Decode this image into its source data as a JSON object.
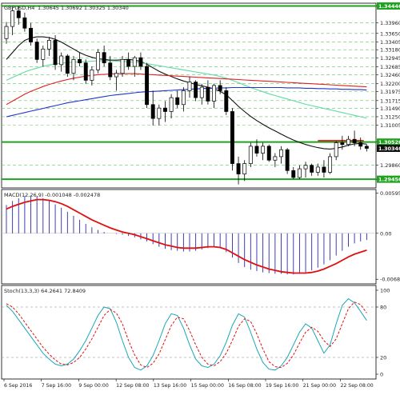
{
  "chart_data": [
    {
      "type": "candlestick",
      "panel": "price",
      "title": "GBPUSD,H4",
      "ohlc_text": "1.30645 1.30692 1.30325 1.30340",
      "y_ticks": [
        "1.34440",
        "1.33960",
        "1.33650",
        "1.33405",
        "1.33180",
        "1.32945",
        "1.32685",
        "1.32460",
        "1.32200",
        "1.31975",
        "1.31715",
        "1.31490",
        "1.31250",
        "1.31005",
        "1.30520",
        "1.29860",
        "1.29450"
      ],
      "highlight_labels": [
        {
          "value": "1.34440",
          "color": "#1fa31f"
        },
        {
          "value": "1.30520",
          "color": "#1fa31f"
        },
        {
          "value": "1.30340",
          "color": "#111111"
        },
        {
          "value": "1.29450",
          "color": "#1fa31f"
        }
      ],
      "ylim": [
        1.292,
        1.3452
      ],
      "levels": [
        {
          "value": 1.3444,
          "color": "#1fa31f"
        },
        {
          "value": 1.3052,
          "color": "#1fa31f"
        },
        {
          "value": 1.3056,
          "color": "#e01010"
        },
        {
          "value": 1.2945,
          "color": "#1fa31f"
        }
      ],
      "candles": [
        [
          1.335,
          1.3398,
          1.3335,
          1.3385
        ],
        [
          1.3385,
          1.344,
          1.336,
          1.343
        ],
        [
          1.343,
          1.3442,
          1.339,
          1.341
        ],
        [
          1.341,
          1.3425,
          1.337,
          1.338
        ],
        [
          1.338,
          1.3395,
          1.333,
          1.334
        ],
        [
          1.334,
          1.335,
          1.328,
          1.329
        ],
        [
          1.329,
          1.333,
          1.327,
          1.332
        ],
        [
          1.332,
          1.3355,
          1.33,
          1.3345
        ],
        [
          1.3345,
          1.336,
          1.326,
          1.3275
        ],
        [
          1.3275,
          1.331,
          1.3255,
          1.33
        ],
        [
          1.33,
          1.3305,
          1.324,
          1.325
        ],
        [
          1.325,
          1.33,
          1.323,
          1.329
        ],
        [
          1.329,
          1.331,
          1.327,
          1.328
        ],
        [
          1.328,
          1.329,
          1.322,
          1.323
        ],
        [
          1.323,
          1.327,
          1.3215,
          1.326
        ],
        [
          1.326,
          1.332,
          1.325,
          1.331
        ],
        [
          1.331,
          1.333,
          1.327,
          1.328
        ],
        [
          1.328,
          1.33,
          1.323,
          1.324
        ],
        [
          1.324,
          1.326,
          1.32,
          1.325
        ],
        [
          1.325,
          1.33,
          1.324,
          1.329
        ],
        [
          1.329,
          1.331,
          1.326,
          1.327
        ],
        [
          1.327,
          1.33,
          1.324,
          1.3295
        ],
        [
          1.3295,
          1.331,
          1.326,
          1.327
        ],
        [
          1.327,
          1.328,
          1.315,
          1.316
        ],
        [
          1.316,
          1.32,
          1.31,
          1.312
        ],
        [
          1.312,
          1.316,
          1.31,
          1.315
        ],
        [
          1.315,
          1.317,
          1.311,
          1.314
        ],
        [
          1.314,
          1.319,
          1.312,
          1.318
        ],
        [
          1.318,
          1.32,
          1.315,
          1.316
        ],
        [
          1.316,
          1.321,
          1.314,
          1.32
        ],
        [
          1.32,
          1.324,
          1.318,
          1.3225
        ],
        [
          1.3225,
          1.323,
          1.317,
          1.318
        ],
        [
          1.318,
          1.322,
          1.316,
          1.321
        ],
        [
          1.321,
          1.323,
          1.316,
          1.317
        ],
        [
          1.317,
          1.322,
          1.315,
          1.3215
        ],
        [
          1.3215,
          1.323,
          1.319,
          1.32
        ],
        [
          1.32,
          1.321,
          1.313,
          1.314
        ],
        [
          1.314,
          1.315,
          1.297,
          1.299
        ],
        [
          1.299,
          1.301,
          1.293,
          1.296
        ],
        [
          1.296,
          1.3,
          1.294,
          1.299
        ],
        [
          1.299,
          1.305,
          1.298,
          1.304
        ],
        [
          1.304,
          1.306,
          1.301,
          1.302
        ],
        [
          1.302,
          1.305,
          1.3,
          1.304
        ],
        [
          1.304,
          1.3045,
          1.2995,
          1.3
        ],
        [
          1.3,
          1.302,
          1.298,
          1.301
        ],
        [
          1.301,
          1.304,
          1.299,
          1.303
        ],
        [
          1.303,
          1.3035,
          1.296,
          1.297
        ],
        [
          1.297,
          1.298,
          1.2945,
          1.295
        ],
        [
          1.295,
          1.2985,
          1.2945,
          1.2975
        ],
        [
          1.2975,
          1.2995,
          1.295,
          1.2985
        ],
        [
          1.2985,
          1.299,
          1.2955,
          1.2965
        ],
        [
          1.2965,
          1.299,
          1.2955,
          1.298
        ],
        [
          1.298,
          1.3,
          1.295,
          1.2965
        ],
        [
          1.2965,
          1.302,
          1.296,
          1.301
        ],
        [
          1.301,
          1.3055,
          1.3,
          1.305
        ],
        [
          1.305,
          1.307,
          1.303,
          1.3045
        ],
        [
          1.3045,
          1.307,
          1.304,
          1.306
        ],
        [
          1.306,
          1.3085,
          1.304,
          1.305
        ],
        [
          1.305,
          1.3065,
          1.303,
          1.304
        ],
        [
          1.304,
          1.3045,
          1.3025,
          1.3034
        ]
      ],
      "moving_averages": [
        {
          "color": "#111111",
          "values": [
            1.329,
            1.331,
            1.333,
            1.3345,
            1.3352,
            1.3355,
            1.3355,
            1.3353,
            1.3348,
            1.334,
            1.333,
            1.332,
            1.331,
            1.3302,
            1.3296,
            1.3292,
            1.329,
            1.3288,
            1.3288,
            1.3289,
            1.329,
            1.3288,
            1.3284,
            1.3276,
            1.3266,
            1.3256,
            1.3248,
            1.3241,
            1.3234,
            1.3228,
            1.3223,
            1.3218,
            1.3214,
            1.321,
            1.3205,
            1.3198,
            1.3188,
            1.3172,
            1.3155,
            1.314,
            1.3126,
            1.3114,
            1.3103,
            1.3093,
            1.3084,
            1.3075,
            1.3066,
            1.3058,
            1.3051,
            1.3045,
            1.304,
            1.3036,
            1.3033,
            1.3032,
            1.3034,
            1.3038,
            1.3043,
            1.3047,
            1.3048,
            1.3046
          ]
        },
        {
          "color": "#5fdba0",
          "values": [
            1.323,
            1.3238,
            1.3246,
            1.3254,
            1.326,
            1.3265,
            1.327,
            1.3274,
            1.3277,
            1.3279,
            1.3281,
            1.3282,
            1.3283,
            1.3284,
            1.3285,
            1.3286,
            1.3286,
            1.3286,
            1.3285,
            1.3284,
            1.3283,
            1.3282,
            1.328,
            1.3278,
            1.3275,
            1.3272,
            1.3269,
            1.3266,
            1.3263,
            1.326,
            1.3257,
            1.3254,
            1.3251,
            1.3248,
            1.3245,
            1.3241,
            1.3236,
            1.323,
            1.3223,
            1.3216,
            1.3209,
            1.3203,
            1.3197,
            1.3191,
            1.3186,
            1.3181,
            1.3176,
            1.3171,
            1.3166,
            1.3161,
            1.3157,
            1.3153,
            1.3149,
            1.3145,
            1.3141,
            1.3137,
            1.3133,
            1.3129,
            1.3125,
            1.3121
          ]
        },
        {
          "color": "#e02020",
          "values": [
            1.316,
            1.317,
            1.318,
            1.319,
            1.3198,
            1.3205,
            1.3212,
            1.3218,
            1.3223,
            1.3228,
            1.3232,
            1.3236,
            1.3239,
            1.3242,
            1.3244,
            1.3246,
            1.3247,
            1.3248,
            1.3249,
            1.3249,
            1.3249,
            1.3249,
            1.3248,
            1.3247,
            1.3246,
            1.3245,
            1.3244,
            1.3243,
            1.3242,
            1.3241,
            1.324,
            1.3239,
            1.3238,
            1.3237,
            1.3236,
            1.3235,
            1.3234,
            1.3233,
            1.3232,
            1.3231,
            1.323,
            1.3229,
            1.3228,
            1.3227,
            1.3226,
            1.3225,
            1.3224,
            1.3223,
            1.3222,
            1.3221,
            1.322,
            1.3219,
            1.3218,
            1.3217,
            1.3216,
            1.3215,
            1.3214,
            1.3213,
            1.3212,
            1.3211
          ]
        },
        {
          "color": "#2233cc",
          "values": [
            1.3125,
            1.3129,
            1.3133,
            1.3137,
            1.3141,
            1.3145,
            1.3149,
            1.3153,
            1.3157,
            1.3161,
            1.3165,
            1.3168,
            1.3171,
            1.3174,
            1.3177,
            1.318,
            1.3183,
            1.3186,
            1.3188,
            1.319,
            1.3192,
            1.3194,
            1.3196,
            1.3197,
            1.3198,
            1.3199,
            1.32,
            1.3201,
            1.3202,
            1.3203,
            1.3204,
            1.3205,
            1.3206,
            1.3207,
            1.3207,
            1.3208,
            1.3208,
            1.3209,
            1.3209,
            1.3209,
            1.3209,
            1.3209,
            1.3209,
            1.3209,
            1.3209,
            1.3209,
            1.3208,
            1.3208,
            1.3208,
            1.3207,
            1.3207,
            1.3206,
            1.3206,
            1.3205,
            1.3205,
            1.3204,
            1.3204,
            1.3203,
            1.3203,
            1.3202
          ]
        }
      ]
    },
    {
      "type": "bar+line",
      "panel": "macd",
      "title": "MACD(12,26,9) -0.001048 -0.002478",
      "y_ticks": [
        "0.005951",
        "0.00",
        "-0.006815"
      ],
      "ylim": [
        -0.0075,
        0.0065
      ],
      "histogram": [
        0.0042,
        0.0048,
        0.0052,
        0.0055,
        0.0056,
        0.0055,
        0.0052,
        0.0048,
        0.0043,
        0.0038,
        0.0032,
        0.0026,
        0.002,
        0.0014,
        0.0009,
        0.0005,
        0.0002,
        0.0,
        -0.0001,
        -0.0002,
        -0.0004,
        -0.0006,
        -0.0009,
        -0.0012,
        -0.0016,
        -0.002,
        -0.0023,
        -0.0025,
        -0.0026,
        -0.0027,
        -0.0027,
        -0.0026,
        -0.0024,
        -0.0022,
        -0.0021,
        -0.0022,
        -0.0028,
        -0.0036,
        -0.0044,
        -0.005,
        -0.0054,
        -0.0056,
        -0.0058,
        -0.0059,
        -0.006,
        -0.006,
        -0.0061,
        -0.0061,
        -0.006,
        -0.0058,
        -0.0055,
        -0.0051,
        -0.0046,
        -0.004,
        -0.0033,
        -0.0026,
        -0.002,
        -0.0015,
        -0.0012,
        -0.001
      ],
      "signal": [
        0.0036,
        0.004,
        0.0043,
        0.0046,
        0.0048,
        0.005,
        0.005,
        0.0049,
        0.0047,
        0.0044,
        0.004,
        0.0035,
        0.003,
        0.0025,
        0.002,
        0.0016,
        0.0012,
        0.0008,
        0.0005,
        0.0002,
        0.0,
        -0.0002,
        -0.0005,
        -0.0008,
        -0.0011,
        -0.0014,
        -0.0017,
        -0.0019,
        -0.0021,
        -0.0022,
        -0.0022,
        -0.0022,
        -0.0021,
        -0.002,
        -0.002,
        -0.0021,
        -0.0024,
        -0.0029,
        -0.0034,
        -0.0039,
        -0.0043,
        -0.0047,
        -0.005,
        -0.0053,
        -0.0055,
        -0.0057,
        -0.0058,
        -0.0059,
        -0.0059,
        -0.0059,
        -0.0058,
        -0.0056,
        -0.0053,
        -0.0049,
        -0.0045,
        -0.004,
        -0.0035,
        -0.0031,
        -0.0028,
        -0.0025
      ]
    },
    {
      "type": "line",
      "panel": "stochastic",
      "title": "Stoch(13,3,3) 64.2641 72.8409",
      "y_ticks": [
        "100",
        "80",
        "20",
        "0"
      ],
      "ylim": [
        0,
        100
      ],
      "levels": [
        80,
        20
      ],
      "main": [
        82,
        75,
        65,
        55,
        45,
        35,
        25,
        18,
        12,
        10,
        12,
        18,
        28,
        40,
        55,
        70,
        80,
        78,
        62,
        40,
        20,
        8,
        5,
        10,
        22,
        40,
        60,
        72,
        70,
        55,
        35,
        18,
        10,
        8,
        12,
        22,
        38,
        58,
        72,
        68,
        50,
        30,
        14,
        6,
        5,
        10,
        20,
        35,
        50,
        60,
        55,
        40,
        25,
        35,
        60,
        82,
        90,
        85,
        75,
        64
      ],
      "signal": [
        84,
        80,
        72,
        62,
        52,
        42,
        32,
        24,
        17,
        12,
        11,
        14,
        20,
        30,
        42,
        56,
        70,
        77,
        73,
        60,
        40,
        23,
        11,
        8,
        13,
        24,
        41,
        58,
        68,
        66,
        52,
        35,
        20,
        12,
        10,
        15,
        25,
        40,
        57,
        66,
        63,
        48,
        30,
        15,
        9,
        8,
        13,
        23,
        37,
        50,
        56,
        51,
        40,
        33,
        42,
        60,
        78,
        86,
        83,
        73
      ]
    },
    {
      "type": "time_axis",
      "x_labels": [
        "6 Sep 2016",
        "7 Sep 16:00",
        "9 Sep 00:00",
        "12 Sep 08:00",
        "13 Sep 16:00",
        "15 Sep 00:00",
        "16 Sep 08:00",
        "19 Sep 16:00",
        "21 Sep 00:00",
        "22 Sep 08:00"
      ]
    }
  ]
}
